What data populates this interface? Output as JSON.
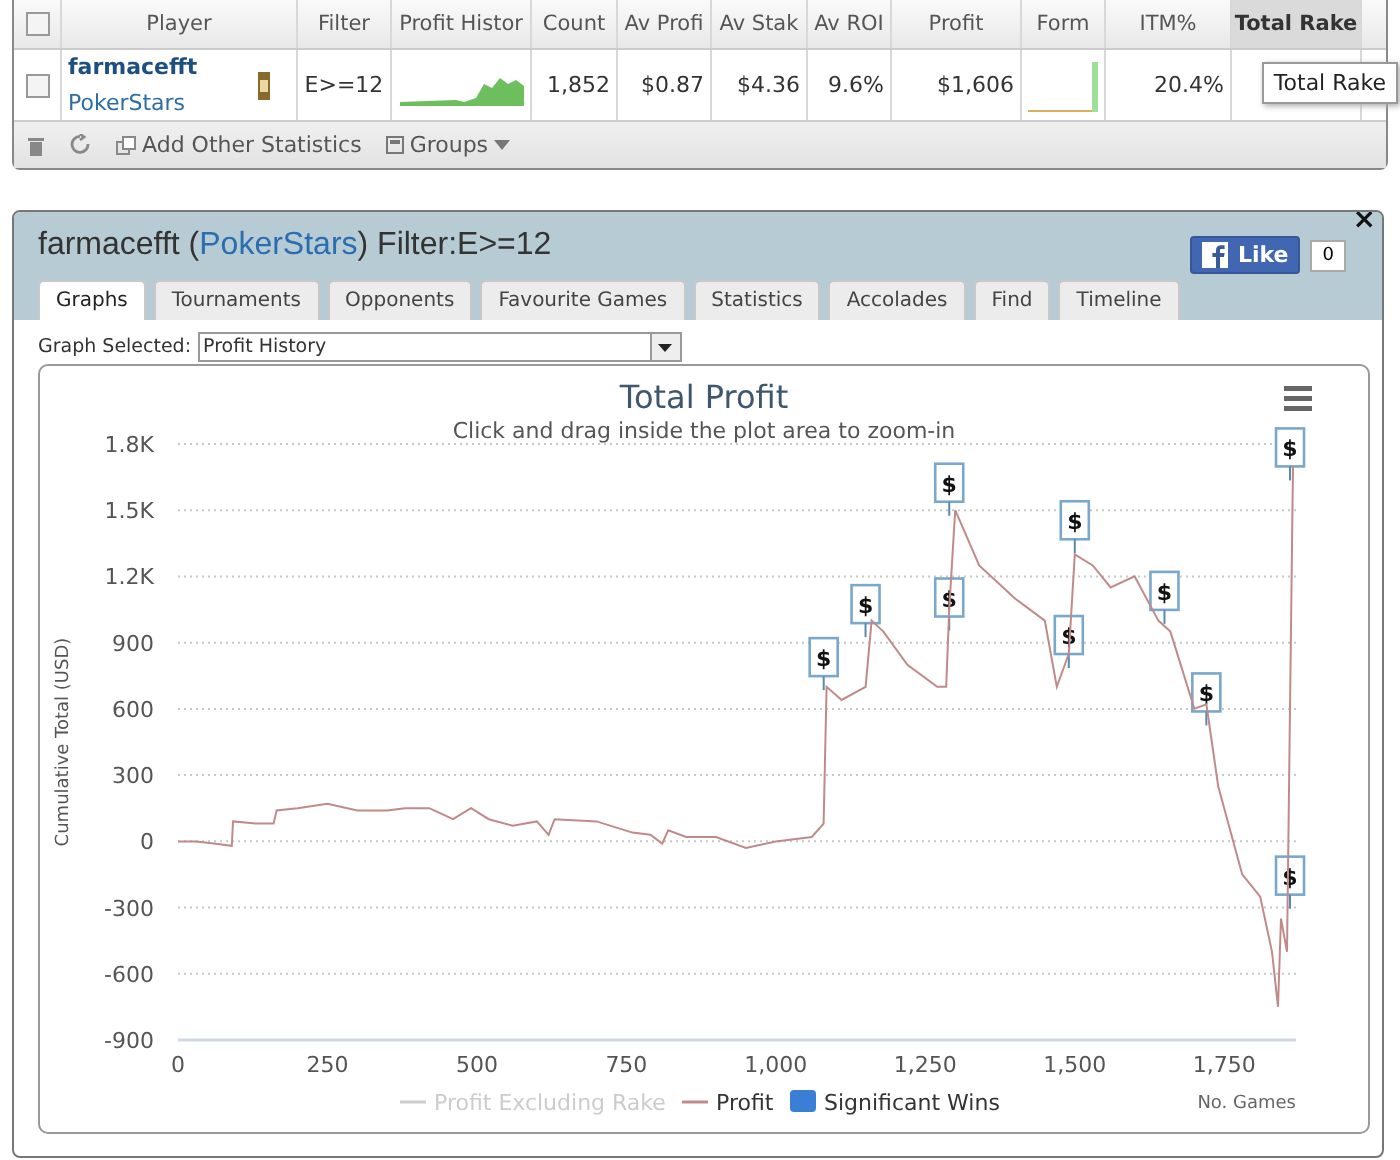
{
  "stats_table": {
    "select_all_checked": false,
    "columns": [
      {
        "label": "Player",
        "selected": false
      },
      {
        "label": "Filter",
        "selected": false
      },
      {
        "label": "Profit Histor",
        "selected": false
      },
      {
        "label": "Count",
        "selected": false
      },
      {
        "label": "Av Profi",
        "selected": false
      },
      {
        "label": "Av Stak",
        "selected": false
      },
      {
        "label": "Av ROI",
        "selected": false
      },
      {
        "label": "Profit",
        "selected": false
      },
      {
        "label": "Form",
        "selected": false
      },
      {
        "label": "ITM%",
        "selected": false
      },
      {
        "label": "Total Rake",
        "selected": true
      }
    ],
    "rows": [
      {
        "checked": false,
        "player": "farmacefft",
        "site": "PokerStars",
        "filter": "E>=12",
        "count": "1,852",
        "av_profit": "$0.87",
        "av_stake": "$4.36",
        "av_roi": "9.6%",
        "profit": "$1,606",
        "itm": "20.4%"
      }
    ],
    "tooltip": "Total Rake",
    "footer": {
      "add_stats": "Add Other Statistics",
      "groups": "Groups"
    }
  },
  "dialog": {
    "player": "farmacefft",
    "open_paren": "(",
    "site": "PokerStars",
    "close_paren": ")",
    "filter": "Filter:E>=12",
    "like": "Like",
    "like_count": "0",
    "close": "×",
    "tabs": [
      {
        "label": "Graphs",
        "selected": true
      },
      {
        "label": "Tournaments",
        "selected": false
      },
      {
        "label": "Opponents",
        "selected": false
      },
      {
        "label": "Favourite Games",
        "selected": false
      },
      {
        "label": "Statistics",
        "selected": false
      },
      {
        "label": "Accolades",
        "selected": false
      },
      {
        "label": "Find",
        "selected": false
      },
      {
        "label": "Timeline",
        "selected": false
      }
    ],
    "graph_label": "Graph Selected:",
    "graph_value": "Profit History",
    "chart_data": {
      "type": "line",
      "grid": true,
      "title": "Total Profit",
      "subtitle": "Click and drag inside the plot area to zoom-in",
      "xlabel": "No. Games",
      "ylabel": "Cumulative Total (USD)",
      "xlim": [
        0,
        1870
      ],
      "ylim": [
        -900,
        1800
      ],
      "xticks": [
        0,
        {
          "value": 250,
          "label": "250"
        },
        {
          "value": 500,
          "label": "500"
        },
        {
          "value": 750,
          "label": "750"
        },
        {
          "value": 1000,
          "label": "1,000"
        },
        {
          "value": 1250,
          "label": "1,250"
        },
        {
          "value": 1500,
          "label": "1,500"
        },
        {
          "value": 1750,
          "label": "1,750"
        }
      ],
      "yticks": [
        {
          "value": -900,
          "label": "-900"
        },
        {
          "value": -600,
          "label": "-600"
        },
        {
          "value": -300,
          "label": "-300"
        },
        0,
        {
          "value": 300,
          "label": "300"
        },
        {
          "value": 600,
          "label": "600"
        },
        {
          "value": 900,
          "label": "900"
        },
        {
          "value": 1200,
          "label": "1.2K"
        },
        {
          "value": 1500,
          "label": "1.5K"
        },
        {
          "value": 1800,
          "label": "1.8K"
        }
      ],
      "x": [
        0,
        30,
        60,
        90,
        92,
        130,
        160,
        165,
        200,
        250,
        300,
        350,
        380,
        420,
        460,
        490,
        520,
        560,
        600,
        620,
        630,
        700,
        760,
        790,
        810,
        820,
        850,
        900,
        950,
        1000,
        1060,
        1080,
        1085,
        1110,
        1150,
        1160,
        1180,
        1220,
        1270,
        1285,
        1290,
        1300,
        1340,
        1400,
        1450,
        1470,
        1490,
        1500,
        1530,
        1560,
        1600,
        1640,
        1660,
        1700,
        1720,
        1740,
        1780,
        1810,
        1830,
        1840,
        1845,
        1855,
        1865
      ],
      "series": [
        {
          "name": "Profit",
          "color": "#c08a8a",
          "values": [
            0,
            0,
            -10,
            -20,
            90,
            80,
            80,
            140,
            150,
            170,
            140,
            140,
            150,
            150,
            100,
            150,
            100,
            70,
            90,
            30,
            100,
            90,
            40,
            30,
            -10,
            50,
            20,
            20,
            -30,
            0,
            20,
            80,
            700,
            640,
            700,
            1000,
            950,
            800,
            700,
            700,
            1050,
            1500,
            1250,
            1100,
            1000,
            700,
            850,
            1300,
            1250,
            1150,
            1200,
            1000,
            950,
            600,
            620,
            250,
            -150,
            -250,
            -500,
            -750,
            -350,
            -500,
            1700
          ]
        }
      ],
      "annotations": [
        {
          "x": 1080,
          "y": 830,
          "text": "$"
        },
        {
          "x": 1150,
          "y": 1070,
          "text": "$"
        },
        {
          "x": 1290,
          "y": 1620,
          "text": "$"
        },
        {
          "x": 1290,
          "y": 1100,
          "text": "$"
        },
        {
          "x": 1500,
          "y": 1450,
          "text": "$"
        },
        {
          "x": 1490,
          "y": 930,
          "text": "$"
        },
        {
          "x": 1650,
          "y": 1130,
          "text": "$"
        },
        {
          "x": 1720,
          "y": 670,
          "text": "$"
        },
        {
          "x": 1860,
          "y": -160,
          "text": "$"
        },
        {
          "x": 1860,
          "y": 1780,
          "text": "$"
        }
      ]
    },
    "legend": [
      {
        "kind": "line",
        "label": "Profit Excluding Rake",
        "color": "#cccccc",
        "disabled": true
      },
      {
        "kind": "series",
        "disabled": false
      },
      {
        "kind": "marker",
        "label": "Significant Wins",
        "color": "#3a7fd5",
        "disabled": false
      }
    ]
  }
}
